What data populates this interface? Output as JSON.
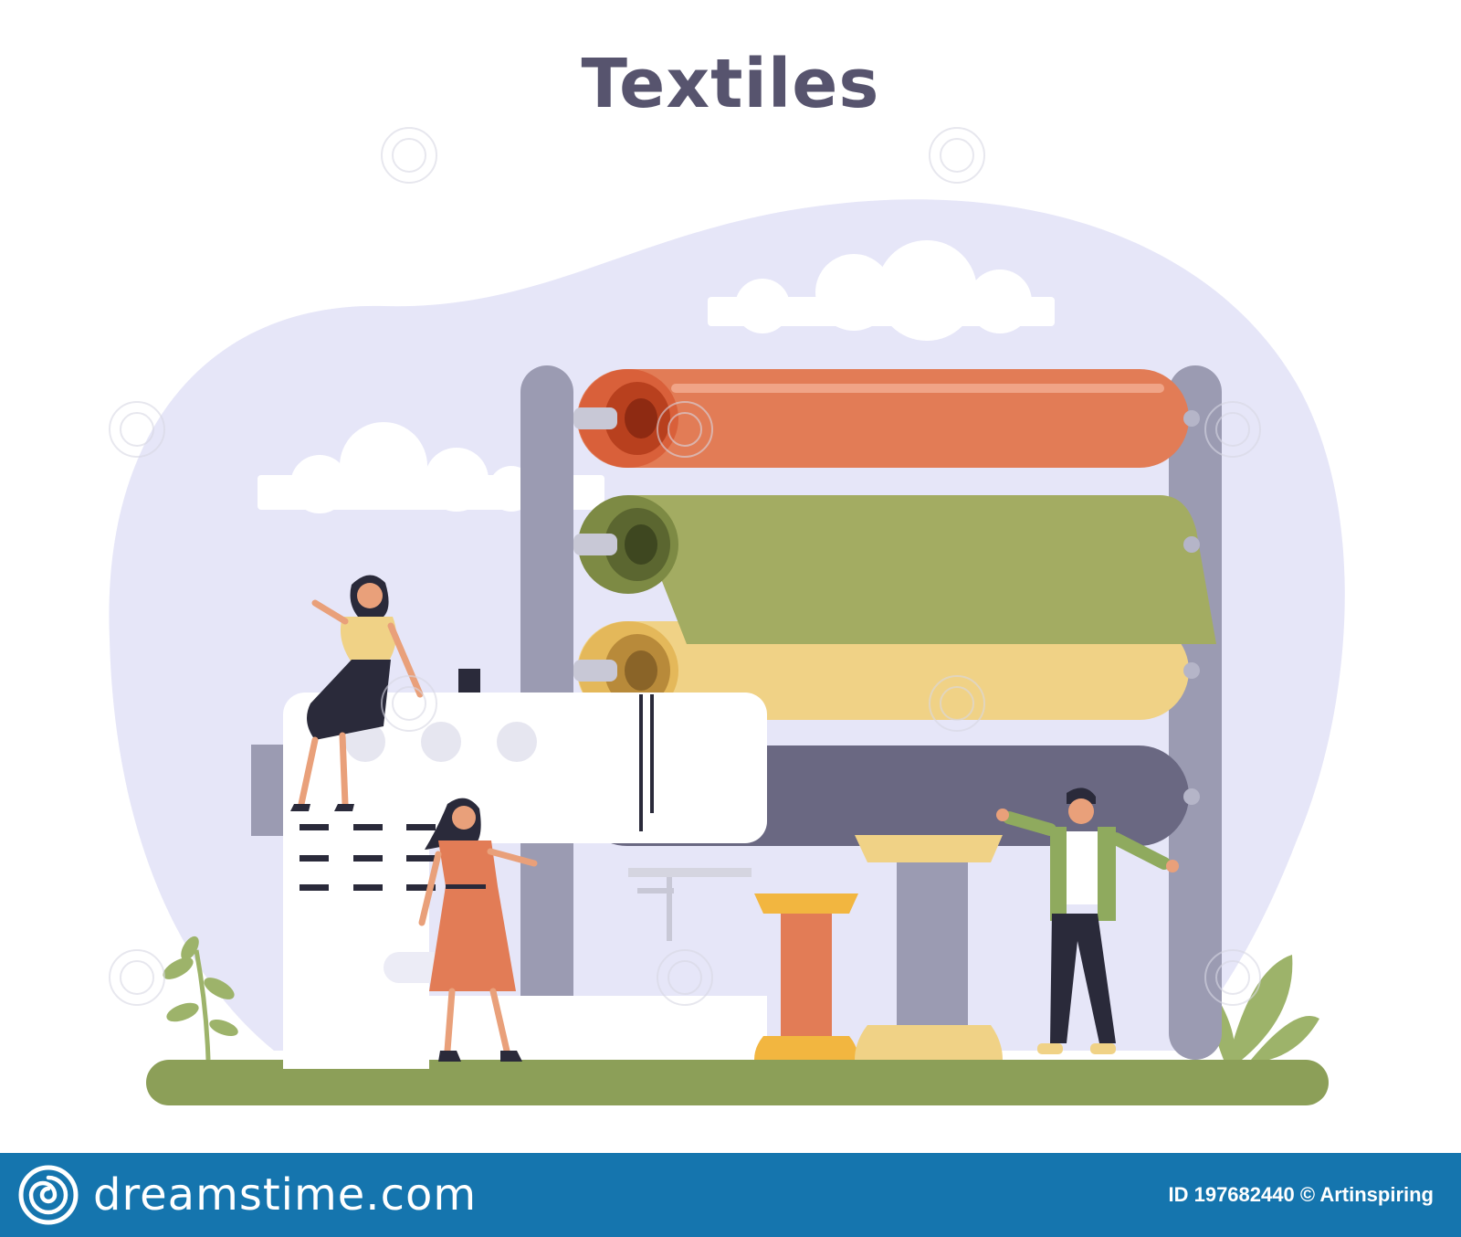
{
  "title": "Textiles",
  "footer": {
    "brand": "dreamstime.com",
    "credit": "ID 197682440 © Artinspiring"
  },
  "watermark_text": "dreamstime",
  "colors": {
    "title": "#57546e",
    "blob": "#e6e6f8",
    "ground": "#8c9f58",
    "frame": "#9b9bb2",
    "roll_orange": "#e27c56",
    "roll_green": "#a3ac62",
    "roll_yellow": "#f0d286",
    "roll_purple": "#6a6882",
    "footer": "#1575ae"
  },
  "icons": [
    "dreamstime-logo-icon"
  ]
}
